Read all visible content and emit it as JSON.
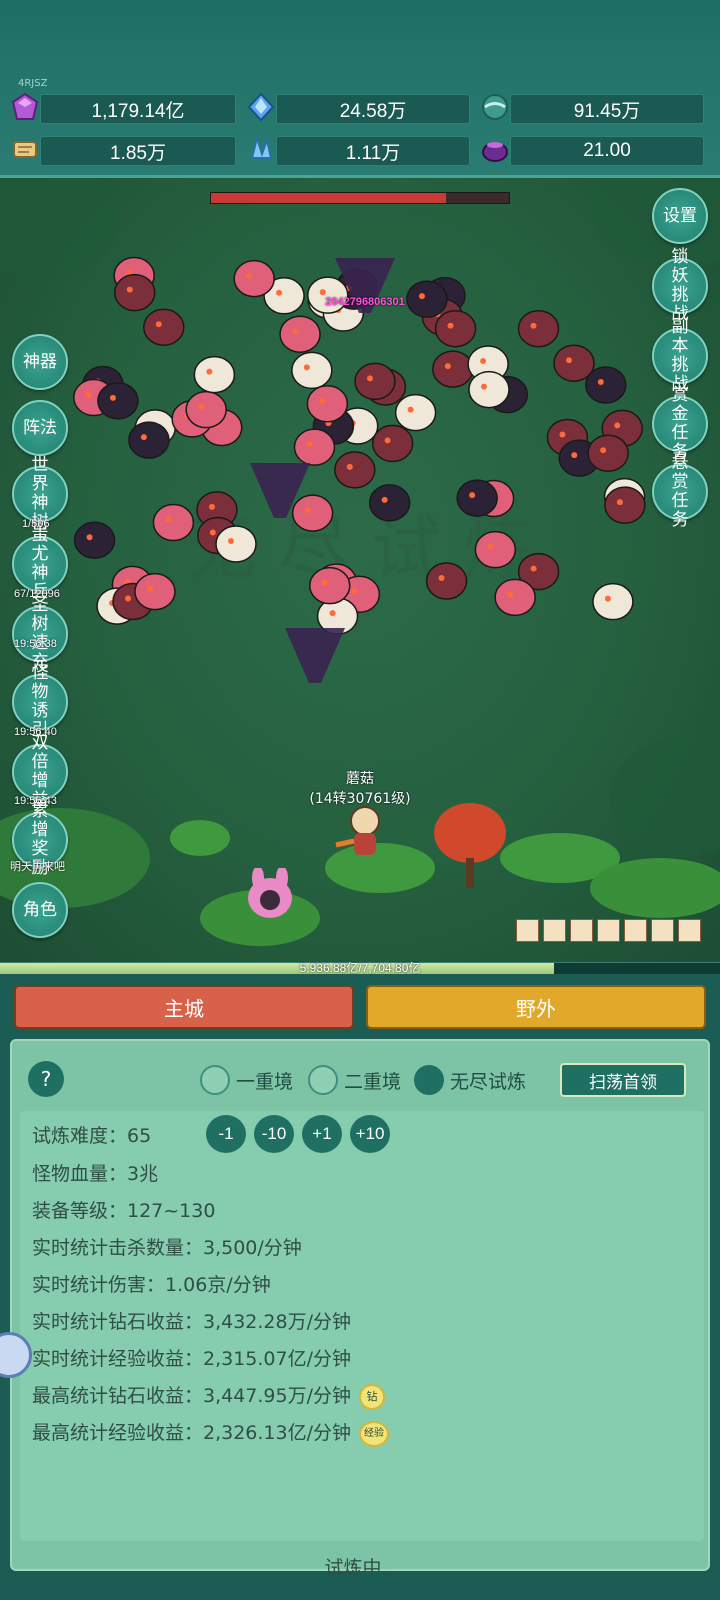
{
  "top": {
    "tiny_label": "4RJSZ",
    "resources": [
      {
        "icon": "purple-gem-icon",
        "value": "1,179.14亿"
      },
      {
        "icon": "blue-crystal-icon",
        "value": "24.58万"
      },
      {
        "icon": "teal-orb-icon",
        "value": "91.45万"
      },
      {
        "icon": "scroll-icon",
        "value": "1.85万"
      },
      {
        "icon": "ice-shard-icon",
        "value": "1.11万"
      },
      {
        "icon": "potion-pot-icon",
        "value": "21.00"
      }
    ]
  },
  "field": {
    "damage_text": "2042796806301",
    "hero_name": "蘑菇",
    "hero_level": "(14转30761级)",
    "left_buttons": [
      {
        "label": "神器"
      },
      {
        "label": "阵法"
      },
      {
        "label": "世界神树",
        "timer": "1/506"
      },
      {
        "label": "蚩尤神兵",
        "timer": "67/12096"
      },
      {
        "label": "圣树速充",
        "timer": "19:56:38"
      },
      {
        "label": "怪物诱引",
        "timer": "19:56:40"
      },
      {
        "label": "双倍增益",
        "timer": "19:56:43"
      },
      {
        "label": "累增奖励",
        "timer": "明天再来吧"
      },
      {
        "label": "角色"
      }
    ],
    "right_buttons": [
      {
        "label": "设置"
      },
      {
        "label": "锁妖挑战"
      },
      {
        "label": "副本挑战"
      },
      {
        "label": "赏金任务"
      },
      {
        "label": "悬赏任务"
      }
    ],
    "boss_hp": 0.79,
    "exp_text": "5,936.88亿/7,704.80亿",
    "exp_ratio": 0.77
  },
  "tabs": {
    "main_city": "主城",
    "wild": "野外"
  },
  "trial": {
    "help": "?",
    "modes": [
      {
        "label": "一重境",
        "selected": false
      },
      {
        "label": "二重境",
        "selected": false
      },
      {
        "label": "无尽试炼",
        "selected": true
      }
    ],
    "sweep_button": "扫荡首领",
    "difficulty_label": "试炼难度：",
    "difficulty_value": "65",
    "adjust_buttons": [
      "-1",
      "-10",
      "+1",
      "+10"
    ],
    "rows": [
      "怪物血量：3兆",
      "装备等级：127~130",
      "实时统计击杀数量：3,500/分钟",
      "实时统计伤害：1.06京/分钟",
      "实时统计钻石收益：3,432.28万/分钟",
      "实时统计经验收益：2,315.07亿/分钟",
      "最高统计钻石收益：3,447.95万/分钟",
      "最高统计经验收益：2,326.13亿/分钟"
    ],
    "badge_diamond": "钻",
    "badge_exp": "经验",
    "status": "试炼中..."
  }
}
